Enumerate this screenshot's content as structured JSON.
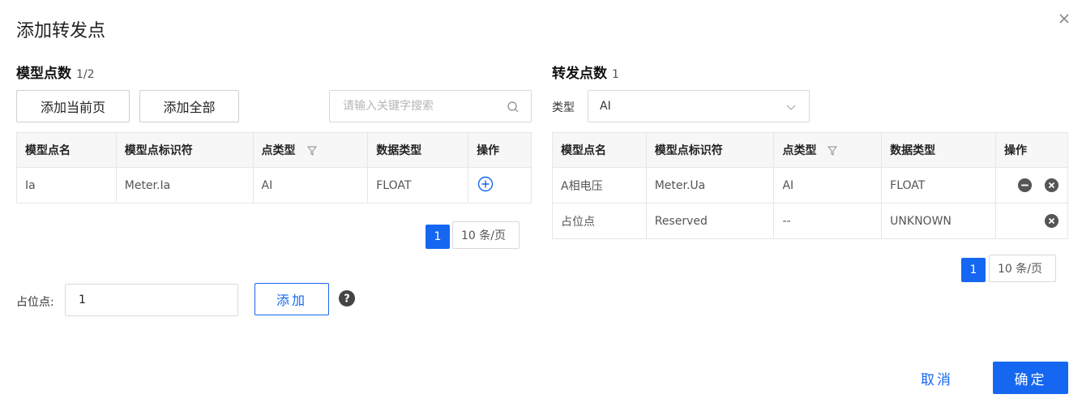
{
  "dialog": {
    "title": "添加转发点",
    "cancel_label": "取消",
    "confirm_label": "确定"
  },
  "left": {
    "title": "模型点数",
    "count": "1/2",
    "add_current_page": "添加当前页",
    "add_all": "添加全部",
    "search_placeholder": "请输入关键字搜索",
    "columns": [
      "模型点名",
      "模型点标识符",
      "点类型",
      "数据类型",
      "操作"
    ],
    "rows": [
      {
        "name": "Ia",
        "identifier": "Meter.Ia",
        "point_type": "AI",
        "data_type": "FLOAT"
      }
    ],
    "page": "1",
    "page_size": "10 条/页"
  },
  "right": {
    "title": "转发点数",
    "count": "1",
    "type_label": "类型",
    "type_value": "AI",
    "columns": [
      "模型点名",
      "模型点标识符",
      "点类型",
      "数据类型",
      "操作"
    ],
    "rows": [
      {
        "name": "A相电压",
        "identifier": "Meter.Ua",
        "point_type": "AI",
        "data_type": "FLOAT"
      },
      {
        "name": "占位点",
        "identifier": "Reserved",
        "point_type": "--",
        "data_type": "UNKNOWN"
      }
    ],
    "page": "1",
    "page_size": "10 条/页"
  },
  "placeholder_point": {
    "label": "占位点:",
    "value": "1",
    "add_label": "添加"
  },
  "colors": {
    "accent": "#1567f2",
    "icon_dark": "#555555"
  }
}
